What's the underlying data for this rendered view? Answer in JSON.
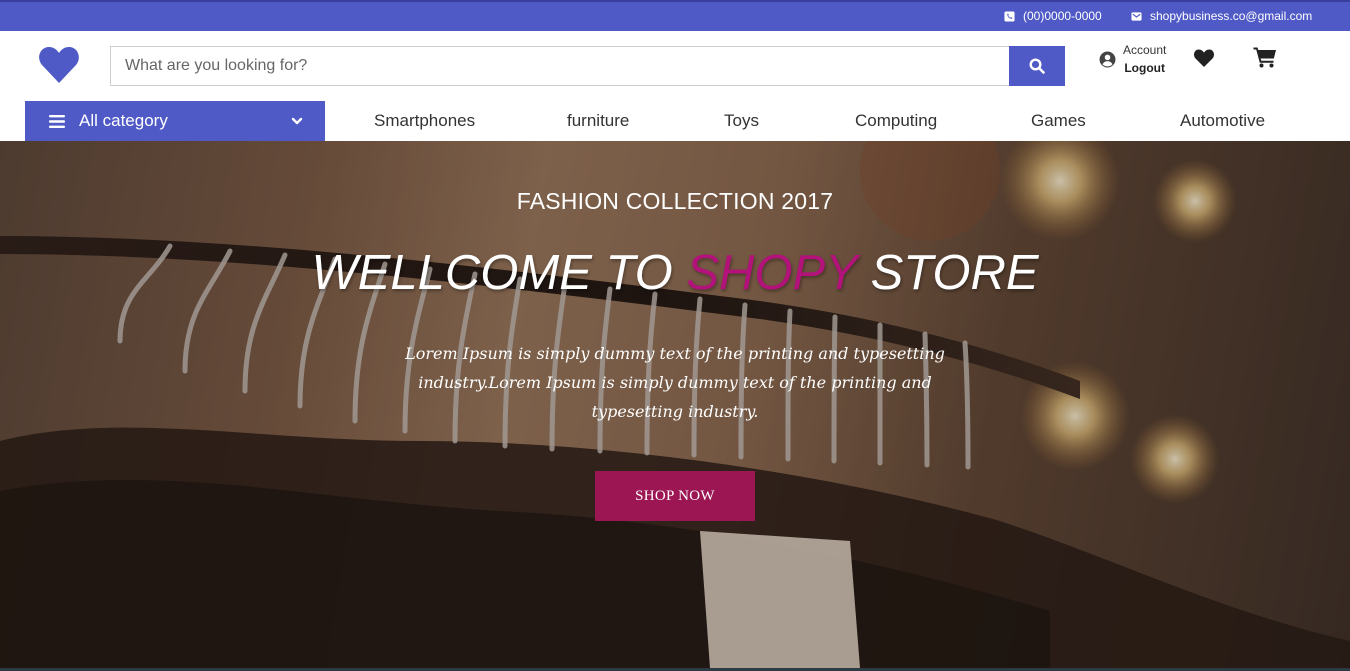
{
  "topbar": {
    "phone": "(00)0000-0000",
    "email": "shopybusiness.co@gmail.com",
    "phone_icon": "phone-icon",
    "mail_icon": "envelope-icon"
  },
  "header": {
    "logo_icon": "heart-logo-icon",
    "search": {
      "placeholder": "What are you looking for?",
      "value": "",
      "button_icon": "search-icon"
    },
    "account_label": "Account",
    "logout_label": "Logout",
    "user_icon": "user-circle-icon",
    "wishlist_icon": "heart-icon",
    "cart_icon": "cart-icon"
  },
  "nav": {
    "all_category": "All category",
    "items": [
      {
        "label": "Smartphones"
      },
      {
        "label": "furniture"
      },
      {
        "label": "Toys"
      },
      {
        "label": "Computing"
      },
      {
        "label": "Games"
      },
      {
        "label": "Automotive"
      }
    ]
  },
  "hero": {
    "subtitle": "FASHION COLLECTION 2017",
    "title_part1": "WELLCOME TO ",
    "title_accent": "SHOPY",
    "title_part2": " STORE",
    "description": "Lorem Ipsum is simply dummy text of the printing and typesetting industry.Lorem Ipsum is simply dummy text of the printing and typesetting industry.",
    "button": "SHOP NOW"
  },
  "colors": {
    "brand": "#4f5ac6",
    "accent": "#b3127a",
    "button": "#9c1654"
  }
}
